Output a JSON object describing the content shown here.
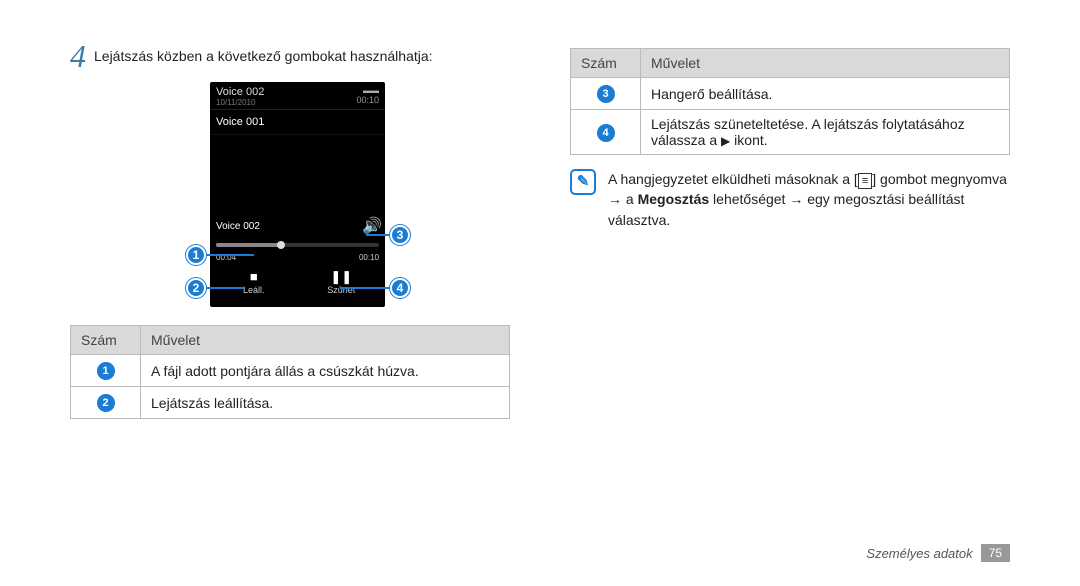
{
  "step": {
    "number": "4",
    "text": "Lejátszás közben a következő gombokat használhatja:"
  },
  "phone": {
    "current_title": "Voice 002",
    "date": "10/11/2010",
    "time": "00:10",
    "list_item": "Voice 001",
    "player_label": "Voice 002",
    "time_elapsed": "00:04",
    "time_total": "00:10",
    "btn_stop": "Leáll.",
    "btn_pause": "Szünet"
  },
  "table_left": {
    "head_num": "Szám",
    "head_op": "Művelet",
    "rows": [
      {
        "num": "1",
        "op": "A fájl adott pontjára állás a csúszkát húzva."
      },
      {
        "num": "2",
        "op": "Lejátszás leállítása."
      }
    ]
  },
  "table_right": {
    "head_num": "Szám",
    "head_op": "Művelet",
    "rows": [
      {
        "num": "3",
        "op": "Hangerő beállítása."
      },
      {
        "num": "4",
        "op_pre": "Lejátszás szüneteltetése. A lejátszás folytatásához válassza a ",
        "op_post": " ikont."
      }
    ]
  },
  "note": {
    "pre": "A hangjegyzetet elküldheti másoknak a [",
    "mid1": "] gombot megnyomva → a ",
    "strong": "Megosztás",
    "mid2": " lehetőséget → egy megosztási beállítást választva."
  },
  "footer": {
    "section": "Személyes adatok",
    "page": "75"
  }
}
